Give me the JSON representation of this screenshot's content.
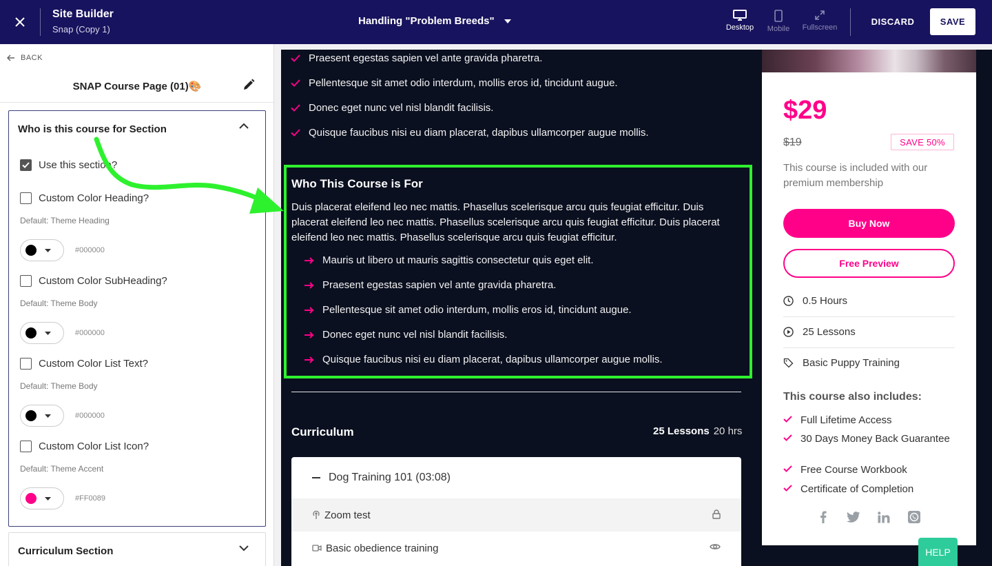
{
  "topbar": {
    "title": "Site Builder",
    "subtitle": "Snap (Copy 1)",
    "page_selector": "Handling \"Problem Breeds\"",
    "devices": [
      {
        "label": "Desktop",
        "icon": "desktop-icon",
        "active": true
      },
      {
        "label": "Mobile",
        "icon": "mobile-icon",
        "active": false
      },
      {
        "label": "Fullscreen",
        "icon": "fullscreen-icon",
        "active": false
      }
    ],
    "discard_label": "DISCARD",
    "save_label": "SAVE",
    "background_color": "#18135e"
  },
  "left_panel": {
    "back_label": "BACK",
    "page_title": "SNAP Course Page (01)",
    "page_title_emoji": "🎨",
    "section": {
      "title": "Who is this course for Section",
      "use_section_label": "Use this section?",
      "use_section_checked": true,
      "options": [
        {
          "label": "Custom Color Heading?",
          "default": "Default: Theme Heading",
          "color": "#000000",
          "hex": "#000000"
        },
        {
          "label": "Custom Color SubHeading?",
          "default": "Default: Theme Body",
          "color": "#000000",
          "hex": "#000000"
        },
        {
          "label": "Custom Color List Text?",
          "default": "Default: Theme Body",
          "color": "#000000",
          "hex": "#000000"
        },
        {
          "label": "Custom Color List Icon?",
          "default": "Default: Theme Accent",
          "color": "#FF0089",
          "hex": "#FF0089"
        }
      ]
    },
    "next_section_title": "Curriculum Section"
  },
  "preview": {
    "check_items": [
      "Praesent egestas sapien vel ante gravida pharetra.",
      "Pellentesque sit amet odio interdum, mollis eros id, tincidunt augue.",
      "Donec eget nunc vel nisl blandit facilisis.",
      "Quisque faucibus nisi eu diam placerat, dapibus ullamcorper augue mollis."
    ],
    "who": {
      "title": "Who This Course is For",
      "body": "Duis placerat eleifend leo nec mattis. Phasellus scelerisque arcu quis feugiat efficitur. Duis placerat eleifend leo nec mattis. Phasellus scelerisque arcu quis feugiat efficitur. Duis placerat eleifend leo nec mattis. Phasellus scelerisque arcu quis feugiat efficitur.",
      "items": [
        "Mauris ut libero ut mauris sagittis consectetur quis eget elit.",
        "Praesent egestas sapien vel ante gravida pharetra.",
        "Pellentesque sit amet odio interdum, mollis eros id, tincidunt augue.",
        "Donec eget nunc vel nisl blandit facilisis.",
        "Quisque faucibus nisi eu diam placerat, dapibus ullamcorper augue mollis."
      ]
    },
    "curriculum": {
      "title": "Curriculum",
      "lessons_count": "25 Lessons",
      "hours": "20 hrs",
      "module": "Dog Training 101 (03:08)",
      "lessons": [
        {
          "title": "Zoom test",
          "icon": "broadcast-icon",
          "status_icon": "lock-icon"
        },
        {
          "title": "Basic obedience training",
          "icon": "video-icon",
          "status_icon": "eye-icon"
        }
      ]
    },
    "card": {
      "price": "$29",
      "old_price": "$19",
      "save_badge": "SAVE 50%",
      "included_text": "This course is included with our premium membership",
      "buy_label": "Buy Now",
      "preview_label": "Free Preview",
      "meta": [
        {
          "icon": "clock-icon",
          "text": "0.5 Hours"
        },
        {
          "icon": "play-circle-icon",
          "text": "25 Lessons"
        },
        {
          "icon": "tag-icon",
          "text": "Basic Puppy Training"
        }
      ],
      "also_title": "This course also includes:",
      "also_items": [
        "Full Lifetime Access",
        "30 Days Money Back Guarantee",
        "Free Course Workbook",
        "Certificate of Completion"
      ],
      "social": [
        "facebook-icon",
        "twitter-icon",
        "linkedin-icon",
        "whatsapp-icon"
      ]
    },
    "accent_color": "#ff0089",
    "highlight_color": "#2ef12e"
  },
  "help_label": "HELP"
}
